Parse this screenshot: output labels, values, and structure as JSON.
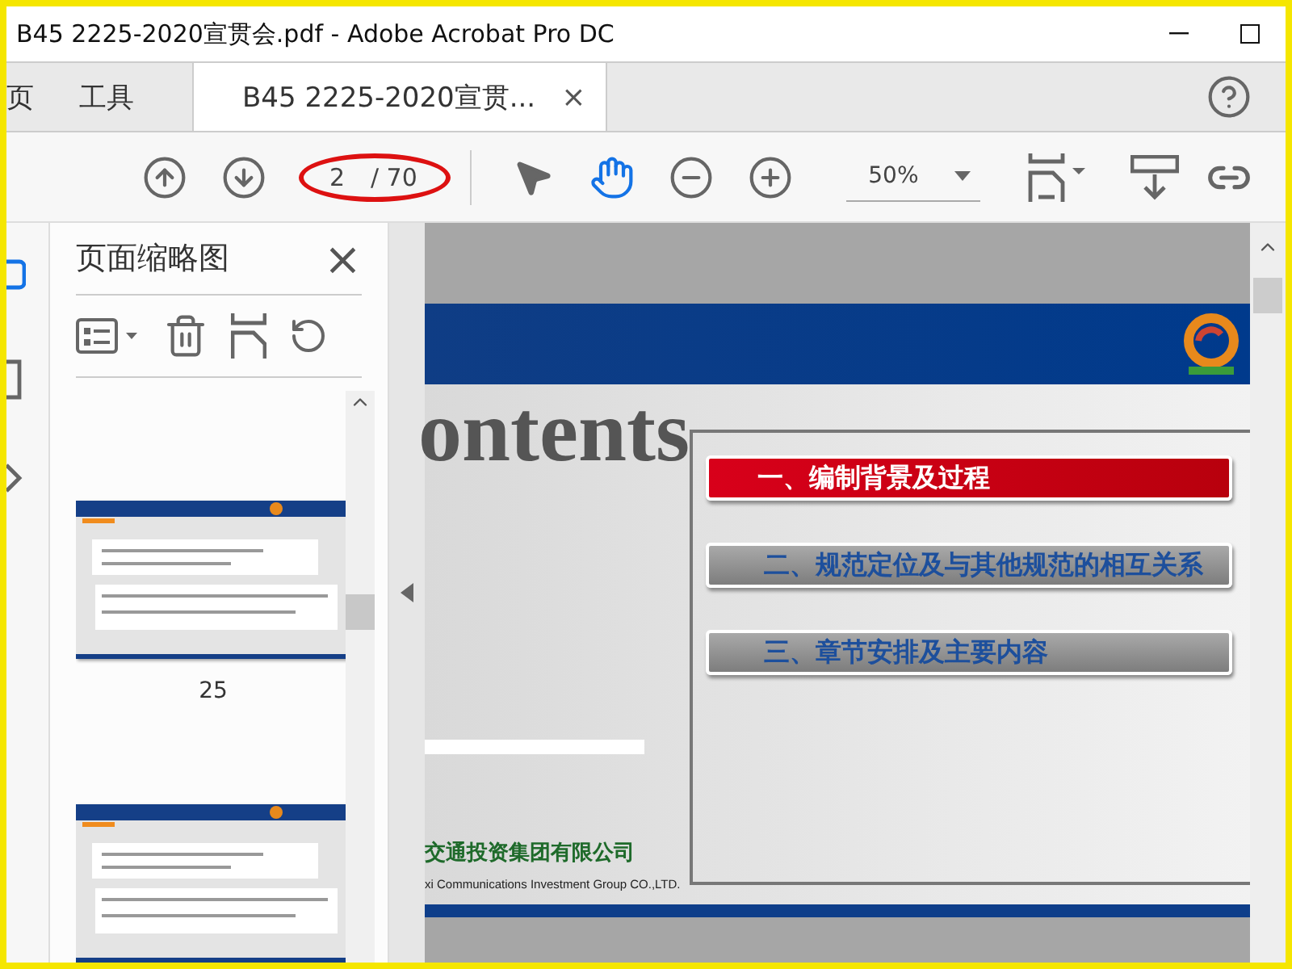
{
  "window": {
    "title": "B45 2225-2020宣贯会.pdf - Adobe Acrobat Pro DC"
  },
  "nav_tabs": [
    {
      "label": "页",
      "selected": false
    },
    {
      "label": "工具",
      "selected": false
    },
    {
      "label": "B45 2225-2020宣贯...",
      "selected": true,
      "close": "×"
    }
  ],
  "toolbar": {
    "page_current": "2",
    "page_total": "/ 70",
    "zoom": "50%",
    "hand_tool_selected": true
  },
  "thumbnails_panel": {
    "title": "页面缩略图",
    "close": "×",
    "pages": [
      {
        "kind": "thumbnail",
        "label": "25"
      },
      {
        "kind": "thumbnail"
      }
    ]
  },
  "slide": {
    "heading": "ontents",
    "menu": [
      {
        "label": "一、编制背景及过程",
        "selected": true
      },
      {
        "label": "二、规范定位及与其他规范的相互关系",
        "selected": false
      },
      {
        "label": "三、章节安排及主要内容",
        "selected": false
      }
    ],
    "company_cn": "交通投资集团有限公司",
    "company_en": "xi Communications Investment Group CO.,LTD."
  }
}
